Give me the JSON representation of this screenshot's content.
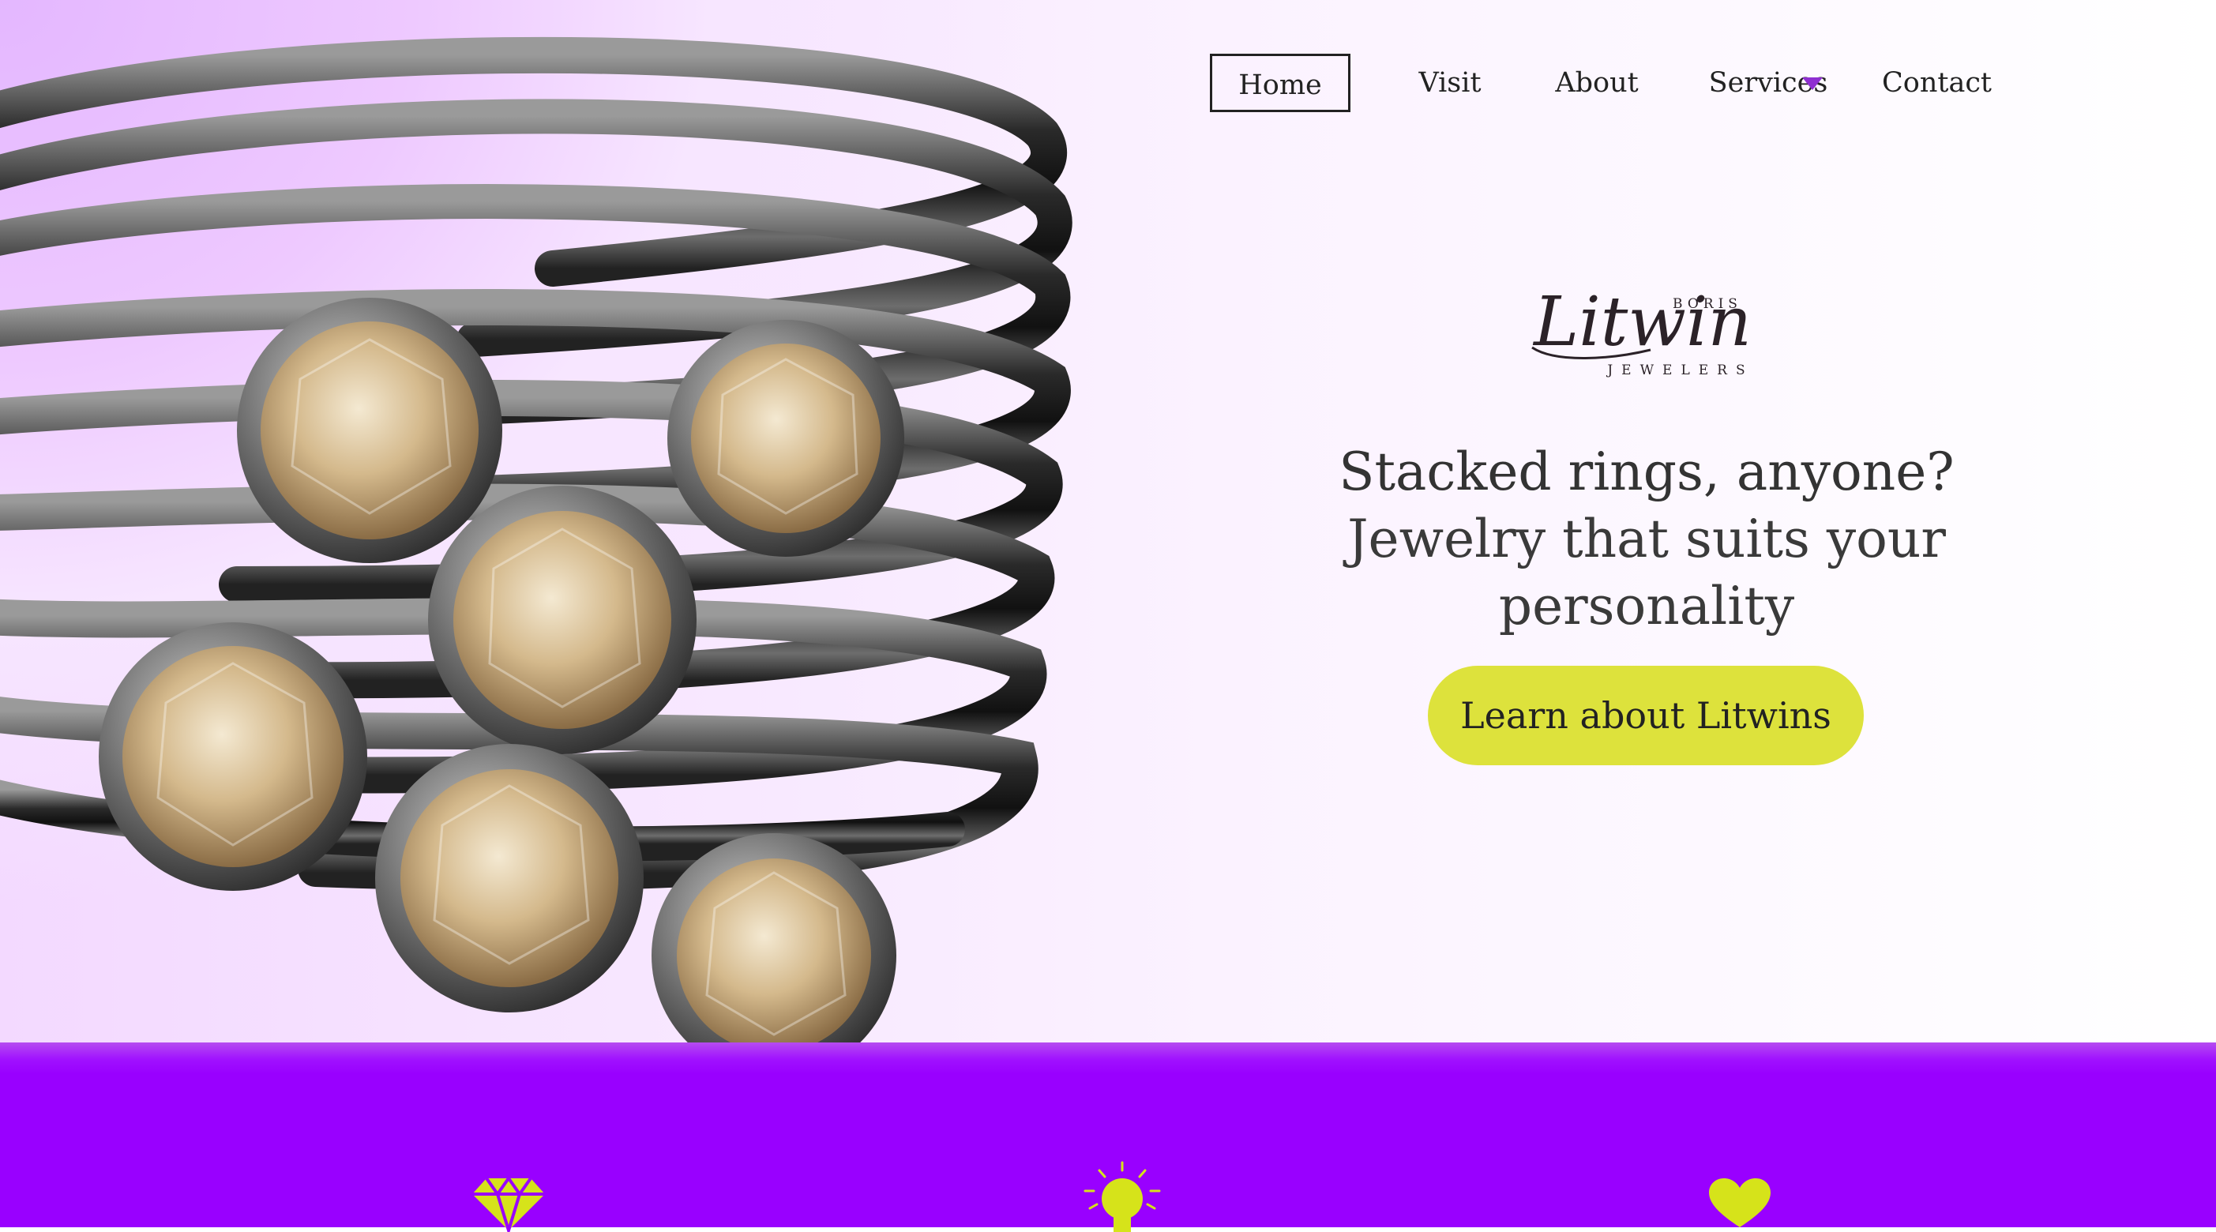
{
  "nav": {
    "items": [
      {
        "label": "Home",
        "active": true
      },
      {
        "label": "Visit"
      },
      {
        "label": "About"
      },
      {
        "label": "Services",
        "has_dropdown": true
      },
      {
        "label": "Contact"
      }
    ]
  },
  "logo": {
    "top_text": "BORIS",
    "script_text": "Litwin",
    "bottom_text": "JEWELERS"
  },
  "hero": {
    "headline_line1": "Stacked rings, anyone?",
    "headline_line2": "Jewelry that suits your personality",
    "cta_label": "Learn about Litwins",
    "image_subject": "stacked-rings-with-rose-cut-diamonds"
  },
  "features": {
    "icons": [
      "diamond-icon",
      "lightbulb-icon",
      "heart-icon"
    ]
  },
  "colors": {
    "accent_purple": "#9900ff",
    "cta_yellow": "#dde23c",
    "icon_yellow": "#d6e31a",
    "caret_purple": "#8f2fd1"
  }
}
